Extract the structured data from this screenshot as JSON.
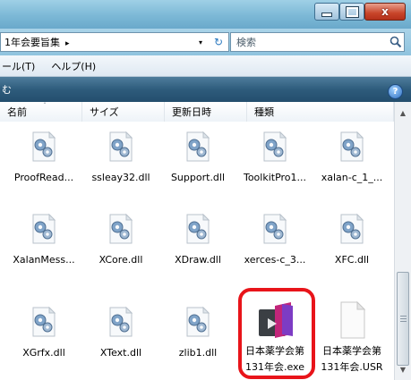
{
  "window": {
    "controls": {
      "minimize_icon": "minimize-icon",
      "maximize_icon": "maximize-icon",
      "close_label": "x"
    }
  },
  "address": {
    "path": "1年会要旨集",
    "separator": "▸",
    "dropdown": "▾",
    "refresh": "↻"
  },
  "search": {
    "placeholder": "検索"
  },
  "menu": {
    "items": [
      "ツール(T)",
      "ヘルプ(H)"
    ],
    "tools_visible": "ール(T)"
  },
  "toolbar": {
    "label": "む",
    "help": "?"
  },
  "columns": {
    "name": "名前",
    "size": "サイズ",
    "modified": "更新日時",
    "type": "種類",
    "sort": "ˆ"
  },
  "files": [
    {
      "name": "ProofRead...",
      "icon": "dll-gear-icon"
    },
    {
      "name": "ssleay32.dll",
      "icon": "dll-gear-icon"
    },
    {
      "name": "Support.dll",
      "icon": "dll-gear-icon"
    },
    {
      "name": "ToolkitPro1...",
      "icon": "dll-gear-icon"
    },
    {
      "name": "xalan-c_1_...",
      "icon": "dll-gear-icon"
    },
    {
      "name": "XalanMess...",
      "icon": "dll-gear-icon"
    },
    {
      "name": "XCore.dll",
      "icon": "dll-gear-icon"
    },
    {
      "name": "XDraw.dll",
      "icon": "dll-gear-icon"
    },
    {
      "name": "xerces-c_3...",
      "icon": "dll-gear-icon"
    },
    {
      "name": "XFC.dll",
      "icon": "dll-gear-icon"
    },
    {
      "name": "XGrfx.dll",
      "icon": "dll-gear-icon"
    },
    {
      "name": "XText.dll",
      "icon": "dll-gear-icon"
    },
    {
      "name": "zlib1.dll",
      "icon": "dll-gear-icon"
    },
    {
      "name": "日本薬学会第\n131年会.exe",
      "line1": "日本薬学会第",
      "line2": "131年会.exe",
      "icon": "exe-app-icon"
    },
    {
      "name": "日本薬学会第\n131年会.USR",
      "line1": "日本薬学会第",
      "line2": "131年会.USR",
      "icon": "blank-file-icon"
    }
  ],
  "colors": {
    "highlight": "#e8141a",
    "toolbar": "#2e5c7c"
  }
}
